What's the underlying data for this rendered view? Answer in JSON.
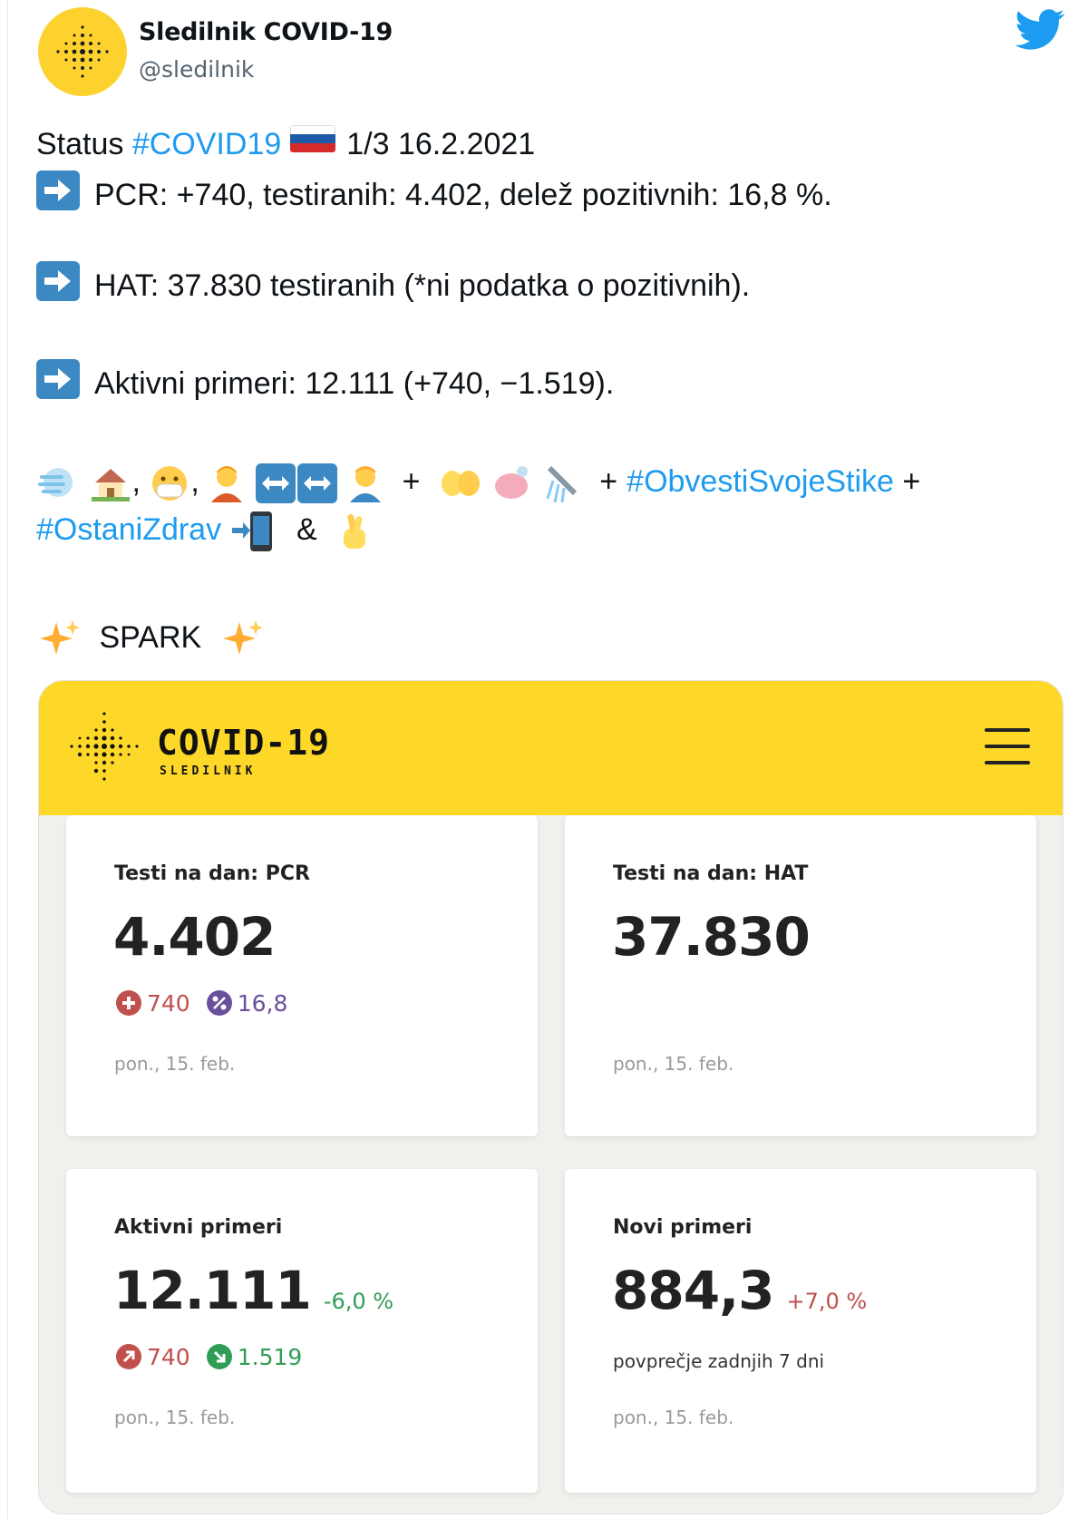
{
  "account": {
    "name": "Sledilnik COVID-19",
    "handle": "@sledilnik"
  },
  "icons": {
    "twitter": "twitter-bird-icon",
    "arrow": "right-arrow-emoji",
    "flag": "slovenia-flag-emoji"
  },
  "colors": {
    "brand_yellow": "#fed829",
    "hashtag_blue": "#1d9bf0",
    "increase_red": "#c0504d",
    "decrease_green": "#2f9d55",
    "percent_purple": "#6a4f9c"
  },
  "tweet": {
    "status_prefix": "Status",
    "status_hashtag": "#COVID19",
    "status_suffix": "1/3 16.2.2021",
    "line_pcr": "PCR: +740, testiranih: 4.402, delež pozitivnih: 16,8 %.",
    "line_hat": "HAT: 37.830 testiranih (*ni podatka o pozitivnih).",
    "line_active": "Aktivni primeri: 12.111 (+740, −1.519).",
    "plus": "+",
    "hashtag_contacts": "#ObvestiSvojeStike",
    "hashtag_health": "#OstaniZdrav",
    "ampersand": "&",
    "spark": "SPARK"
  },
  "card": {
    "brand_title": "COVID-19",
    "brand_subtitle": "SLEDILNIK",
    "menu_icon": "hamburger-menu-icon",
    "tiles": [
      {
        "label": "Testi na dan: PCR",
        "value": "4.402",
        "badge_plus": "740",
        "badge_pct": "16,8",
        "date": "pon., 15. feb."
      },
      {
        "label": "Testi na dan: HAT",
        "value": "37.830",
        "date": "pon., 15. feb."
      },
      {
        "label": "Aktivni primeri",
        "value": "12.111",
        "change": "-6,0 %",
        "up": "740",
        "down": "1.519",
        "date": "pon., 15. feb."
      },
      {
        "label": "Novi primeri",
        "value": "884,3",
        "change": "+7,0 %",
        "note": "povprečje zadnjih 7 dni",
        "date": "pon., 15. feb."
      }
    ]
  }
}
